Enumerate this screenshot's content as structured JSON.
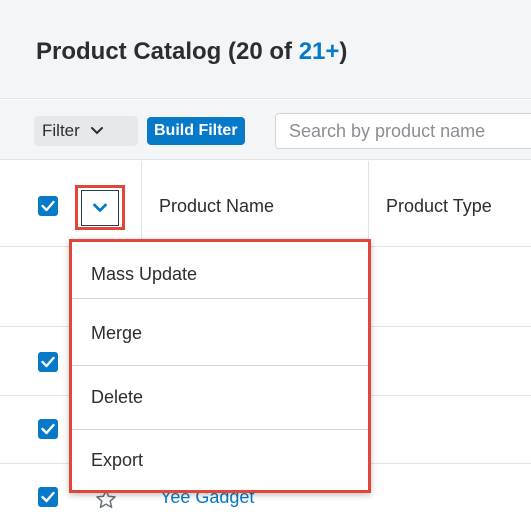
{
  "header": {
    "title": "Product Catalog (20 of ",
    "title_count": "21+",
    "title_close": ")"
  },
  "filterbar": {
    "filter_label": "Filter",
    "build_filter_label": "Build Filter",
    "search_placeholder": "Search by product name"
  },
  "table": {
    "columns": [
      "Product Name",
      "Product Type"
    ],
    "visible_link": "Yee Gadget"
  },
  "mass_actions_menu": {
    "items": [
      "Mass Update",
      "Merge",
      "Delete",
      "Export"
    ]
  },
  "colors": {
    "accent": "#0679c8",
    "highlight": "#e0473a"
  }
}
